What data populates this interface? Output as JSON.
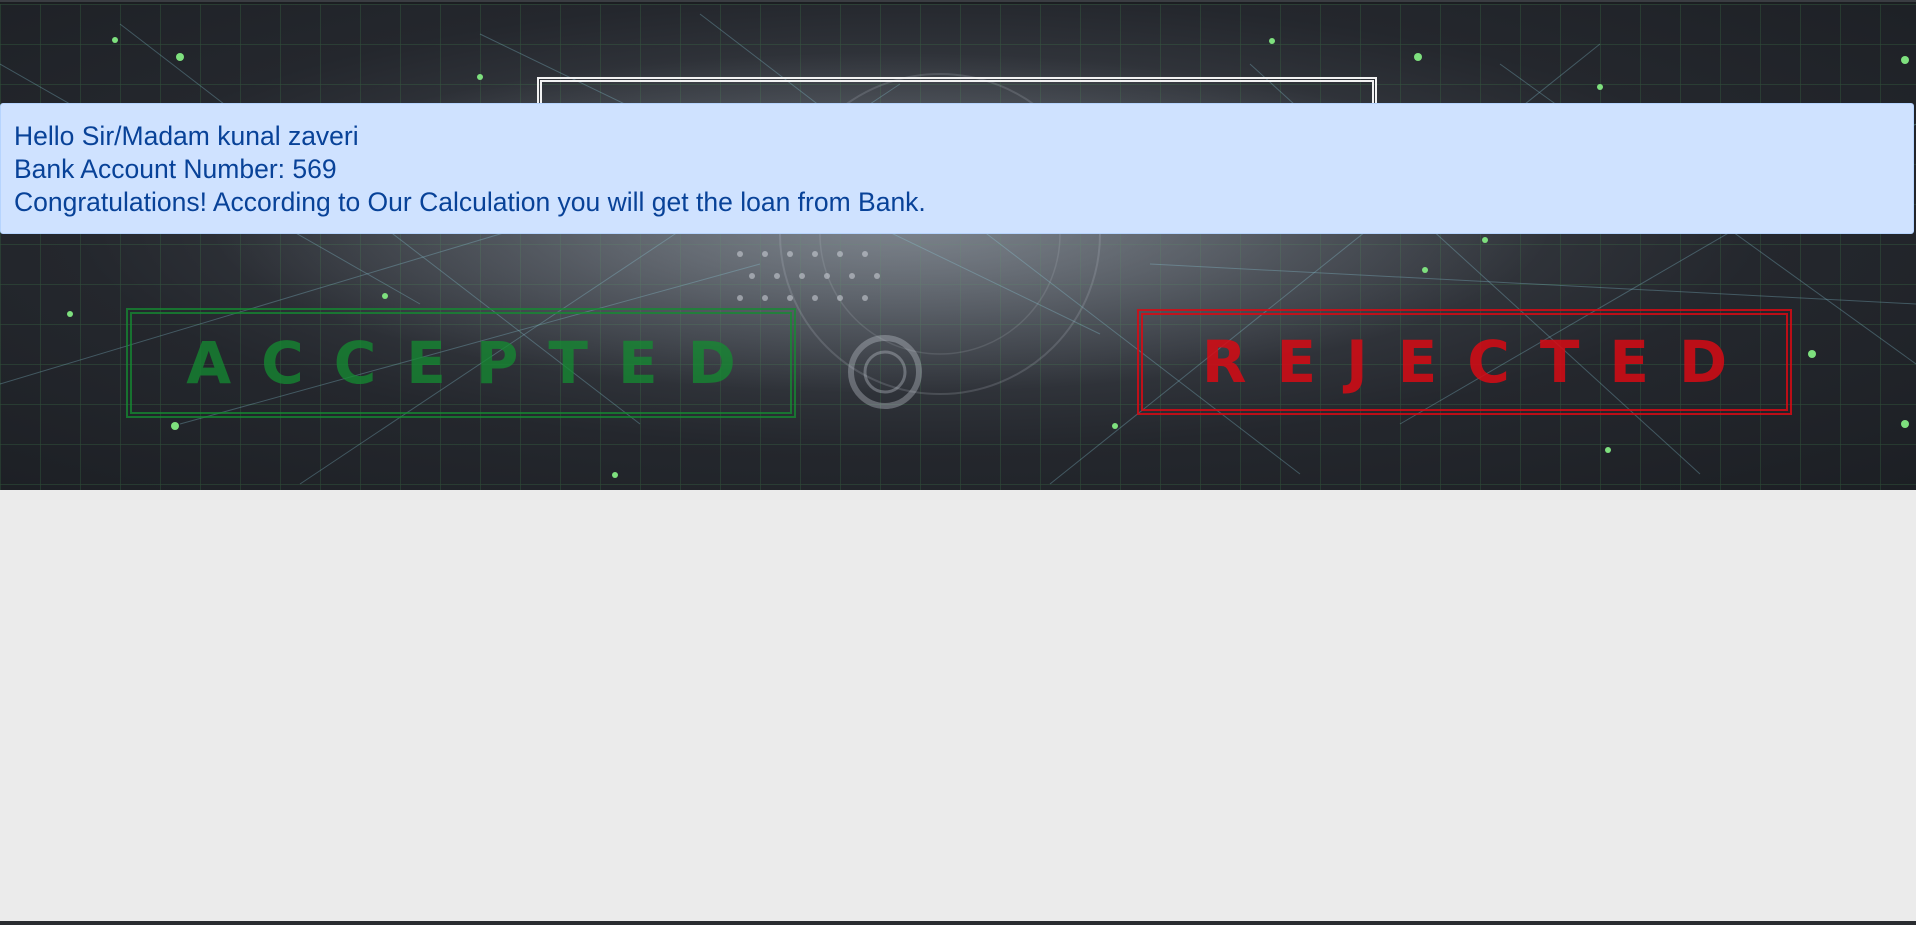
{
  "alert": {
    "greeting": "Hello Sir/Madam kunal zaveri",
    "account": "Bank Account Number: 569",
    "message": "Congratulations! According to Our Calculation you will get the loan from Bank."
  },
  "banner": {
    "accepted_stamp": "ACCEPTED",
    "rejected_stamp": "REJECTED"
  },
  "colors": {
    "alert_bg": "#cfe2ff",
    "alert_text": "#084298",
    "accepted": "#148c32",
    "rejected": "#d70a14",
    "page_bg": "#ebebeb"
  }
}
